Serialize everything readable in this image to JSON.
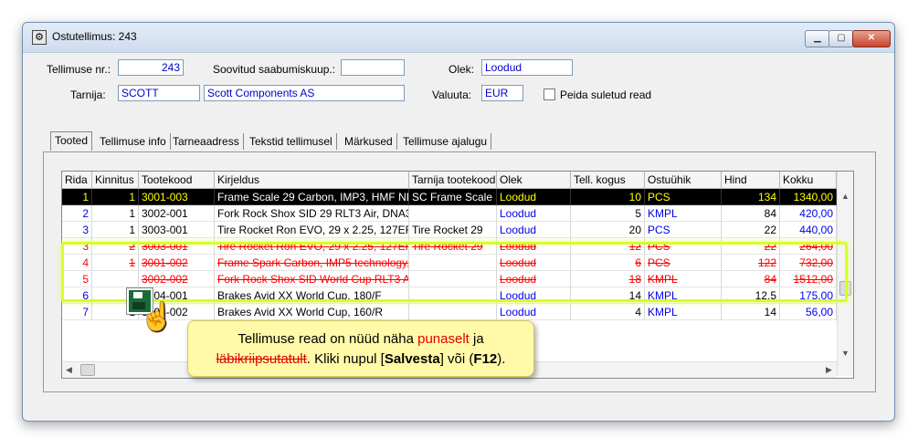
{
  "window": {
    "title": "Ostutellimus: 243",
    "icon": "gear-icon",
    "controls": [
      "minimize",
      "maximize",
      "close"
    ]
  },
  "header": {
    "order_no_label": "Tellimuse nr.:",
    "order_no": "243",
    "arrival_label": "Soovitud saabumiskuup.:",
    "arrival_value": "",
    "status_label": "Olek:",
    "status_value": "Loodud",
    "supplier_label": "Tarnija:",
    "supplier_code": "SCOTT",
    "supplier_name": "Scott Components AS",
    "currency_label": "Valuuta:",
    "currency_value": "EUR",
    "show_closed_label": "Peida suletud read",
    "show_closed_checked": false
  },
  "tabs": [
    "Tooted",
    "Tellimuse info",
    "Tarneaadress",
    "Tekstid tellimusel",
    "Märkused",
    "Tellimuse ajalugu"
  ],
  "table": {
    "columns": [
      "Rida",
      "Kinnitus",
      "Tootekood",
      "Kirjeldus",
      "Tarnija tootekood",
      "Olek",
      "Tell. kogus",
      "Ostuühik",
      "Hind",
      "Kokku"
    ],
    "rows": [
      {
        "rida": "1",
        "kinnitus": "1",
        "kood": "3001-003",
        "kirjeldus": "Frame Scale 29 Carbon, IMP3, HMF NE",
        "tarnija_kood": "SC Frame Scale",
        "olek": "Loodud",
        "kogus": "10",
        "yhik": "PCS",
        "hind": "134",
        "kokku": "1340,00",
        "state": "selected"
      },
      {
        "rida": "2",
        "kinnitus": "1",
        "kood": "3002-001",
        "kirjeldus": "Fork Rock Shox SID 29 RLT3 Air, DNA3",
        "tarnija_kood": "",
        "olek": "Loodud",
        "kogus": "5",
        "yhik": "KMPL",
        "hind": "84",
        "kokku": "420,00",
        "state": "normal"
      },
      {
        "rida": "3",
        "kinnitus": "1",
        "kood": "3003-001",
        "kirjeldus": "Tire Rocket Ron EVO, 29 x 2.25, 127EF",
        "tarnija_kood": "Tire Rocket 29",
        "olek": "Loodud",
        "kogus": "20",
        "yhik": "PCS",
        "hind": "22",
        "kokku": "440,00",
        "state": "normal"
      },
      {
        "rida": "3",
        "kinnitus": "2",
        "kood": "3003-001",
        "kirjeldus": "Tire Rocket Ron EVO, 29 x 2.25, 127EF",
        "tarnija_kood": "Tire Rocket 29",
        "olek": "Loodud",
        "kogus": "12",
        "yhik": "PCS",
        "hind": "22",
        "kokku": "264,00",
        "state": "deleted"
      },
      {
        "rida": "4",
        "kinnitus": "1",
        "kood": "3001-002",
        "kirjeldus": "Frame Spark Carbon, IMP5 technology, I",
        "tarnija_kood": "",
        "olek": "Loodud",
        "kogus": "6",
        "yhik": "PCS",
        "hind": "122",
        "kokku": "732,00",
        "state": "deleted"
      },
      {
        "rida": "5",
        "kinnitus": "",
        "kood": "3002-002",
        "kirjeldus": "Fork Rock Shox SID World Cup RLT3 A",
        "tarnija_kood": "",
        "olek": "Loodud",
        "kogus": "18",
        "yhik": "KMPL",
        "hind": "84",
        "kokku": "1512,00",
        "state": "deleted"
      },
      {
        "rida": "6",
        "kinnitus": "",
        "kood": "3004-001",
        "kirjeldus": "Brakes Avid XX World Cup, 180/F",
        "tarnija_kood": "",
        "olek": "Loodud",
        "kogus": "14",
        "yhik": "KMPL",
        "hind": "12,5",
        "kokku": "175,00",
        "state": "normal"
      },
      {
        "rida": "7",
        "kinnitus": "1",
        "kood": "3004-002",
        "kirjeldus": "Brakes Avid XX World Cup, 160/R",
        "tarnija_kood": "",
        "olek": "Loodud",
        "kogus": "4",
        "yhik": "KMPL",
        "hind": "14",
        "kokku": "56,00",
        "state": "normal"
      }
    ]
  },
  "callout": {
    "part1": "Tellimuse read on nüüd näha ",
    "red_word": "punaselt",
    "part2": " ja",
    "strike_word": "läbikriipsutatult",
    "part3": ". Kliki nupul [",
    "save_word": "Salvesta",
    "part4": "] või (",
    "key_word": "F12",
    "part5": ")."
  }
}
